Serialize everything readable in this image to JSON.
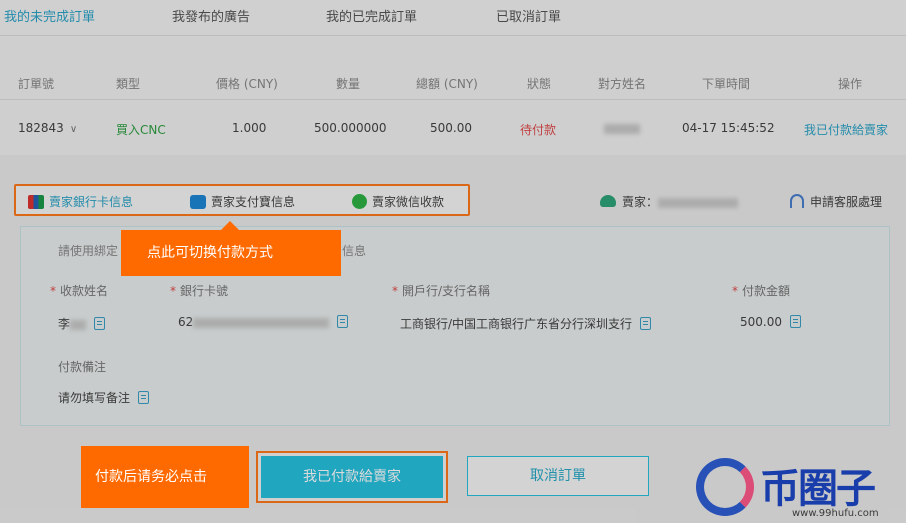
{
  "tabs": [
    {
      "label": "我的未完成訂單",
      "active": true
    },
    {
      "label": "我發布的廣告",
      "active": false
    },
    {
      "label": "我的已完成訂單",
      "active": false
    },
    {
      "label": "已取消訂單",
      "active": false
    }
  ],
  "table": {
    "headers": [
      "訂單號",
      "類型",
      "價格 (CNY)",
      "數量",
      "總額 (CNY)",
      "狀態",
      "對方姓名",
      "下單時間",
      "操作"
    ],
    "row": {
      "order_no": "182843",
      "type": "買入CNC",
      "price": "1.000",
      "quantity": "500.000000",
      "total": "500.00",
      "status": "待付款",
      "time": "04-17 15:45:52",
      "action": "我已付款給賣家"
    }
  },
  "payment": {
    "tabs": [
      "賣家銀行卡信息",
      "賣家支付寶信息",
      "賣家微信收款"
    ],
    "seller_label": "賣家：",
    "service": "申請客服處理",
    "hint_prefix": "請使用綁定",
    "hint_suffix": "信息",
    "fields": {
      "name_label": "收款姓名",
      "name_value": "李",
      "card_label": "銀行卡號",
      "card_value": "62",
      "bank_label": "開戶行/支行名稱",
      "bank_value": "工商银行/中国工商银行广东省分行深圳支行",
      "amount_label": "付款金額",
      "amount_value": "500.00",
      "note_label": "付款備注",
      "note_value": "请勿填写备注"
    }
  },
  "tooltips": {
    "switch": "点此可切换付款方式",
    "confirm": "付款后请务必点击"
  },
  "buttons": {
    "paid": "我已付款給賣家",
    "cancel": "取消訂單"
  },
  "watermark": {
    "brand": "币圈子",
    "url": "www.99hufu.com"
  },
  "colors": {
    "accent": "#27c2df",
    "highlight": "#ff6a00",
    "buy_green": "#2ea043",
    "pending_red": "#e04b4b"
  }
}
